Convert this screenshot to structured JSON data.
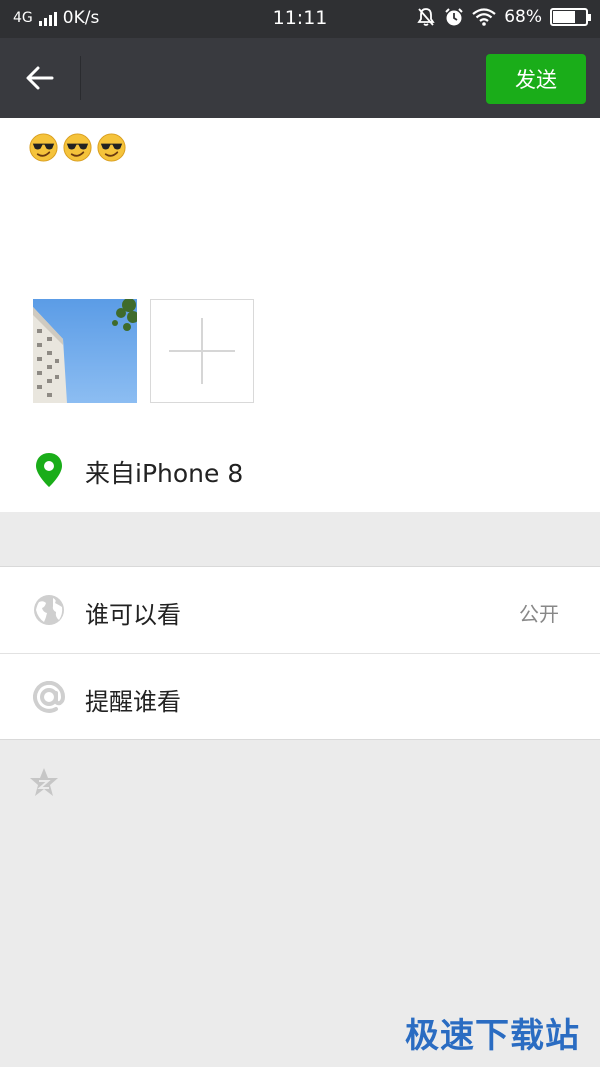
{
  "status_bar": {
    "network": "4G",
    "speed": "0K/s",
    "time": "11:11",
    "battery": "68%",
    "battery_level": 0.68
  },
  "nav": {
    "send_label": "发送",
    "accent_color": "#1aad19"
  },
  "compose": {
    "emojis": [
      "sunglasses-emoji",
      "sunglasses-emoji",
      "sunglasses-emoji"
    ],
    "location_label": "来自iPhone 8"
  },
  "settings": {
    "visibility_label": "谁可以看",
    "visibility_value": "公开",
    "mention_label": "提醒谁看"
  },
  "watermark": "极速下载站"
}
